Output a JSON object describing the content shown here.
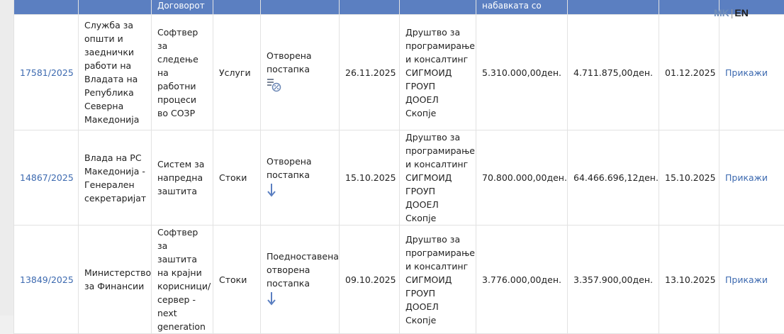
{
  "header": {
    "col_contract_subject": "Договорот",
    "col_value": "набавката со ДДВ"
  },
  "lang": {
    "mk": "MK",
    "sep": "|",
    "en": "EN"
  },
  "rows": [
    {
      "id": "17581/2025",
      "institution": "Служба за општи и заеднички работи на Владата на Република Северна Македонија",
      "subject": "Софтвер за следење на работни процеси во СОЗР",
      "type": "Услуги",
      "procedure": "Отворена постапка",
      "procedure_icon": "percent-tag-icon",
      "date_published": "26.11.2025",
      "supplier": "Друштво за програмирање и консалтинг СИГМОИД ГРОУП ДООЕЛ Скопје",
      "estimated_value": "5.310.000,00ден.",
      "contract_value": "4.711.875,00ден.",
      "date_contract": "01.12.2025",
      "action": "Прикажи"
    },
    {
      "id": "14867/2025",
      "institution": "Влада на РС Македонија - Генерален секретаријат",
      "subject": "Систем за напредна заштита",
      "type": "Стоки",
      "procedure": "Отворена постапка",
      "procedure_icon": "arrow-down-icon",
      "date_published": "15.10.2025",
      "supplier": "Друштво за програмирање и консалтинг СИГМОИД ГРОУП ДООЕЛ Скопје",
      "estimated_value": "70.800.000,00ден.",
      "contract_value": "64.466.696,12ден.",
      "date_contract": "15.10.2025",
      "action": "Прикажи"
    },
    {
      "id": "13849/2025",
      "institution": "Министерство за Финансии",
      "subject": "Софтвер за заштита на крајни корисници/ сервер - next generation",
      "type": "Стоки",
      "procedure": "Поедноставена отворена постапка",
      "procedure_icon": "arrow-down-icon",
      "date_published": "09.10.2025",
      "supplier": "Друштво за програмирање и консалтинг СИГМОИД ГРОУП ДООЕЛ Скопје",
      "estimated_value": "3.776.000,00ден.",
      "contract_value": "3.357.900,00ден.",
      "date_contract": "13.10.2025",
      "action": "Прикажи"
    }
  ]
}
